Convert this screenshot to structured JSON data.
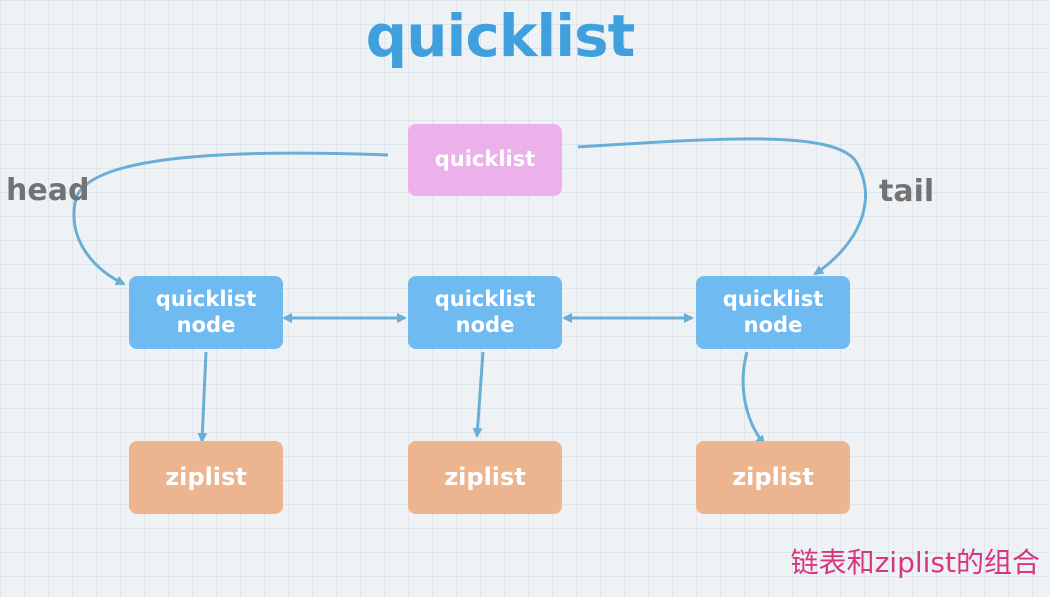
{
  "title": "quicklist",
  "quicklist_box": {
    "label": "quicklist"
  },
  "head_label": "head",
  "tail_label": "tail",
  "nodes": [
    {
      "line1": "quicklist",
      "line2": "node"
    },
    {
      "line1": "quicklist",
      "line2": "node"
    },
    {
      "line1": "quicklist",
      "line2": "node"
    }
  ],
  "ziplists": [
    {
      "label": "ziplist"
    },
    {
      "label": "ziplist"
    },
    {
      "label": "ziplist"
    }
  ],
  "caption": "链表和ziplist的组合",
  "colors": {
    "title": "#3fa0dd",
    "quicklist_box": "#ecb0ea",
    "node_box": "#6fbaf0",
    "ziplist_box": "#ecb48f",
    "arrow": "#6aaed8",
    "caption": "#d6377f"
  }
}
